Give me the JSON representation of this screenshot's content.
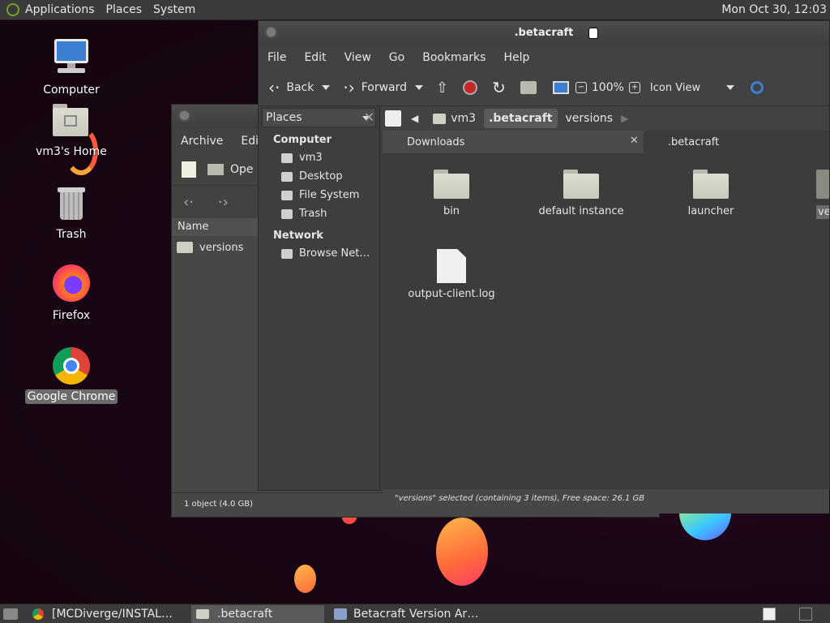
{
  "top_panel": {
    "menus": [
      "Applications",
      "Places",
      "System"
    ],
    "clock": "Mon Oct 30, 12:03"
  },
  "desktop_icons": [
    {
      "label": "Computer",
      "icon": "computer-icon"
    },
    {
      "label": "vm3's Home",
      "icon": "home-folder-icon"
    },
    {
      "label": "Trash",
      "icon": "trash-icon"
    },
    {
      "label": "Firefox",
      "icon": "firefox-icon"
    },
    {
      "label": "Google Chrome",
      "icon": "chrome-icon",
      "selected": true
    }
  ],
  "archive_window": {
    "menus": [
      "Archive",
      "Edit"
    ],
    "open_label": "Ope",
    "column_name": "Name",
    "row": "versions",
    "status": "1 object (4.0 GB)"
  },
  "file_manager": {
    "title": ".betacraft",
    "menus": [
      "File",
      "Edit",
      "View",
      "Go",
      "Bookmarks",
      "Help"
    ],
    "toolbar": {
      "back": "Back",
      "forward": "Forward",
      "zoom": "100%",
      "view_mode": "Icon View"
    },
    "places_selector": "Places",
    "sidebar": {
      "sections": [
        {
          "title": "Computer",
          "items": [
            "vm3",
            "Desktop",
            "File System",
            "Trash"
          ]
        },
        {
          "title": "Network",
          "items": [
            "Browse Net…"
          ]
        }
      ]
    },
    "path": [
      "vm3",
      ".betacraft",
      "versions"
    ],
    "tabs": [
      "Downloads",
      ".betacraft"
    ],
    "files": [
      {
        "name": "bin",
        "type": "folder"
      },
      {
        "name": "default instance",
        "type": "folder"
      },
      {
        "name": "launcher",
        "type": "folder"
      },
      {
        "name": "ve",
        "type": "folder"
      },
      {
        "name": "output-client.log",
        "type": "file"
      }
    ],
    "status": "\"versions\" selected (containing 3 items), Free space: 26.1 GB"
  },
  "taskbar": {
    "tasks": [
      "[MCDiverge/INSTAL…",
      ".betacraft",
      "Betacraft Version Ar…"
    ]
  },
  "colors": {
    "panel": "#3b3b3b",
    "window": "#474747",
    "content": "#3c3c3c",
    "folder": "#d4d4c8",
    "desktop": "#1a0616"
  }
}
